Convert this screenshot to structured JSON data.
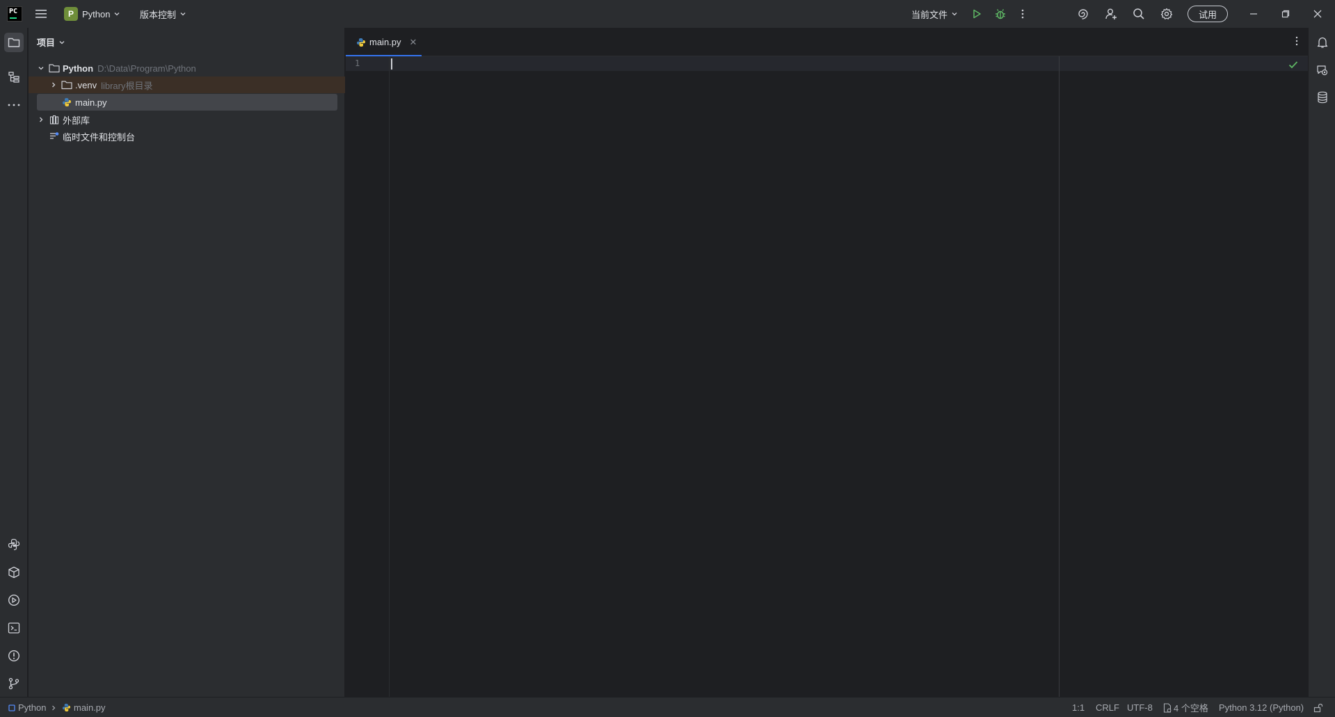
{
  "titlebar": {
    "project_initial": "P",
    "project_name": "Python",
    "vcs_label": "版本控制",
    "run_config_label": "当前文件",
    "trial_label": "试用"
  },
  "project_panel": {
    "header": "项目",
    "tree": {
      "root_name": "Python",
      "root_path": "D:\\Data\\Program\\Python",
      "venv_name": ".venv",
      "venv_hint": "library根目录",
      "file_name": "main.py",
      "external_libs": "外部库",
      "scratches": "临时文件和控制台"
    }
  },
  "editor": {
    "tab_label": "main.py",
    "line_number": "1"
  },
  "statusbar": {
    "crumb_project": "Python",
    "crumb_file": "main.py",
    "position": "1:1",
    "line_separator": "CRLF",
    "encoding": "UTF-8",
    "indent": "4 个空格",
    "interpreter": "Python 3.12 (Python)"
  },
  "colors": {
    "accent": "#3574f0",
    "run_green": "#5fb865",
    "project_badge": "#6f8e3a",
    "panel_bg": "#2b2d30",
    "editor_bg": "#1e1f22"
  }
}
